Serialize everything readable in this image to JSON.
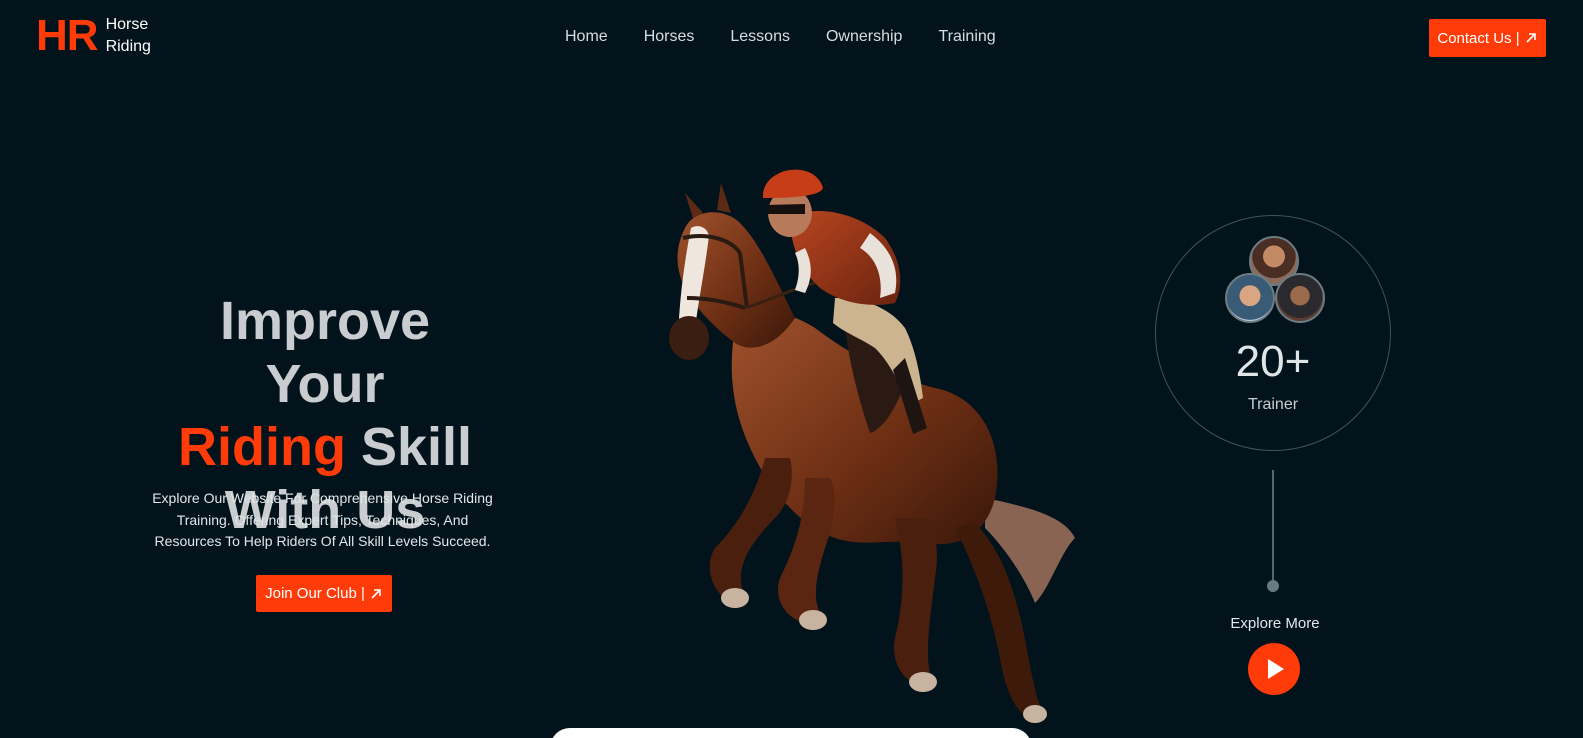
{
  "colors": {
    "background": "#02131c",
    "accent": "#ff3b0a",
    "heading": "#c9cdd0",
    "text": "#e2e6e8",
    "circle_border": "#3e545d"
  },
  "header": {
    "logo": {
      "mark": "HR",
      "line1": "Horse",
      "line2": "Riding"
    },
    "nav": [
      {
        "label": "Home"
      },
      {
        "label": "Horses"
      },
      {
        "label": "Lessons"
      },
      {
        "label": "Ownership"
      },
      {
        "label": "Training"
      }
    ],
    "contact_button": {
      "label": "Contact Us |",
      "icon": "arrow-up-right-icon"
    }
  },
  "hero": {
    "title_line1": "Improve Your",
    "title_accent": "Riding",
    "title_line2_rest": " Skill",
    "title_line3": "With Us",
    "description": "Explore Our Website For Comprehensive Horse Riding Training. Offering Expert Tips, Techniques, And Resources To Help Riders Of All Skill Levels Succeed.",
    "join_button": {
      "label": "Join Our Club |",
      "icon": "arrow-up-right-icon"
    },
    "image": {
      "subject": "jockey riding a galloping chestnut horse"
    }
  },
  "stats": {
    "number": "20+",
    "label": "Trainer",
    "avatars": [
      "trainer-avatar",
      "trainer-avatar",
      "trainer-avatar"
    ]
  },
  "explore": {
    "label": "Explore More",
    "icon": "play-icon"
  }
}
